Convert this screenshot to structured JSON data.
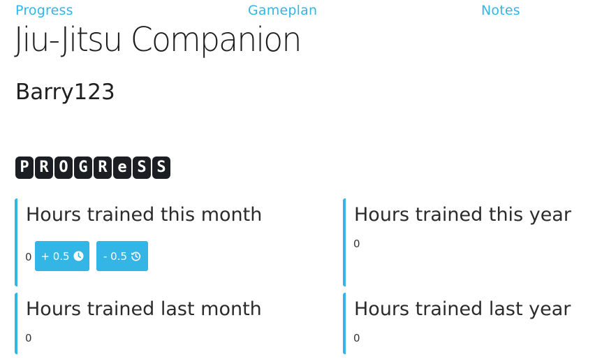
{
  "nav": {
    "items": [
      "Progress",
      "Gameplan",
      "Notes"
    ]
  },
  "app": {
    "title": "Jiu-Jitsu Companion"
  },
  "user": {
    "name": "Barry123"
  },
  "section": {
    "badge_letters": [
      "P",
      "R",
      "O",
      "G",
      "R",
      "e",
      "S",
      "S"
    ]
  },
  "cards": {
    "month": {
      "title": "Hours trained this month",
      "value": "0"
    },
    "year": {
      "title": "Hours trained this year",
      "value": "0"
    },
    "last_month": {
      "title": "Hours trained last month",
      "value": "0"
    },
    "last_year": {
      "title": "Hours trained last year",
      "value": "0"
    }
  },
  "actions": {
    "add_label": "+ 0.5",
    "add_icon": "clock-icon",
    "remove_label": "- 0.5",
    "remove_icon": "history-icon"
  },
  "colors": {
    "accent": "#33b5e5",
    "tile": "#1b1f24"
  }
}
